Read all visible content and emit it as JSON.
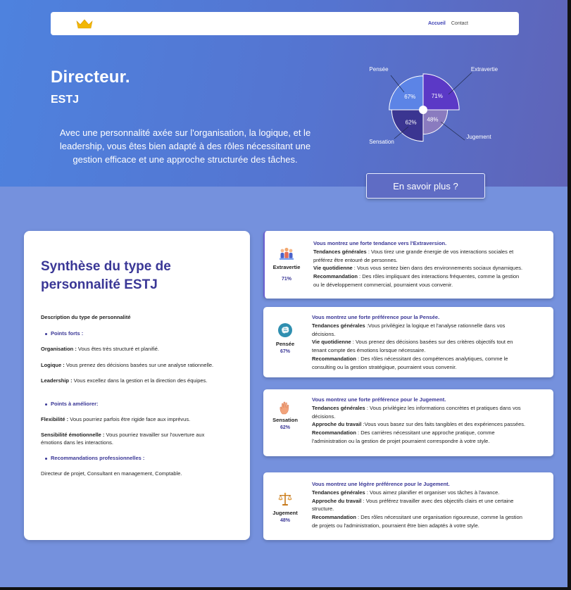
{
  "nav": {
    "logo": "crown-icon",
    "links": [
      "Accueil",
      "Contact"
    ],
    "active_link": "Accueil"
  },
  "hero": {
    "title": "Directeur.",
    "subtitle": "ESTJ",
    "description": " Avec une personnalité axée sur l'organisation, la logique, et le leadership, vous êtes bien adapté à des rôles nécessitant une gestion efficace et une approche structurée des tâches.",
    "cta_label": "En savoir plus ?"
  },
  "chart_data": {
    "type": "pie",
    "categories": [
      "Extravertie",
      "Jugement",
      "Sensation",
      "Pensée"
    ],
    "values": [
      71,
      48,
      62,
      67
    ],
    "value_labels": [
      "71%",
      "48%",
      "62%",
      "67%"
    ],
    "colors": [
      "#5b39c6",
      "#8a7bbf",
      "#3b3591",
      "#5c84e6"
    ]
  },
  "summary": {
    "title": "Synthèse du type de personnalité ESTJ",
    "description_heading": "Description du type de personnalité",
    "strengths_heading": "Points forts :",
    "strengths": [
      {
        "label": "Organisation :",
        "text": " Vous êtes très structuré et planifié."
      },
      {
        "label": "Logique :",
        "text": " Vous prenez des décisions basées sur une analyse rationnelle."
      },
      {
        "label": "Leadership :",
        "text": " Vous excellez dans la gestion et la direction des équipes."
      }
    ],
    "improve_heading": "Points à améliorer:",
    "improvements": [
      {
        "label": "Flexibilité :",
        "text": " Vous pourriez parfois être rigide face aux imprévus."
      },
      {
        "label": "Sensibilité émotionnelle :",
        "text": " Vous pourriez travailler sur l'ouverture aux",
        "text2": "émotions dans les interactions."
      }
    ],
    "careers_heading": "Recommandations professionnelles :",
    "careers_text": "Directeur de projet, Consultant en management, Comptable."
  },
  "traits": [
    {
      "name": "Extravertie",
      "percent": "71%",
      "icon": "people-icon",
      "headline": "Vous montrez une forte tendance vers l'Extraversion.",
      "lines": [
        {
          "label": "Tendances générales",
          "text": " : Vous tirez une grande énergie de vos interactions sociales et"
        },
        {
          "label": "",
          "text": "préférez être entouré de personnes."
        },
        {
          "label": "Vie quotidienne",
          "text": " : Vous vous sentez bien dans des environnements sociaux dynamiques."
        },
        {
          "label": "Recommandation",
          "text": " : Des rôles impliquant des interactions fréquentes, comme la gestion"
        },
        {
          "label": "",
          "text": "ou le développement commercial, pourraient vous convenir."
        }
      ]
    },
    {
      "name": "Pensée",
      "percent": "67%",
      "icon": "brain-icon",
      "headline": "Vous montrez une forte préférence pour la Pensée.",
      "lines": [
        {
          "label": "Tendances générales",
          "text": " :Vous privilégiez la logique et l'analyse rationnelle dans vos"
        },
        {
          "label": "",
          "text": "décisions."
        },
        {
          "label": "Vie quotidienne",
          "text": " :  Vous prenez des décisions basées sur des critères objectifs tout en"
        },
        {
          "label": "",
          "text": "tenant compte des émotions lorsque nécessaire."
        },
        {
          "label": "Recommandation",
          "text": " : Des rôles nécessitant des compétences analytiques, comme le"
        },
        {
          "label": "",
          "text": "consulting ou la gestion stratégique, pourraient vous convenir."
        }
      ]
    },
    {
      "name": "Sensation",
      "percent": "62%",
      "icon": "hand-icon",
      "headline": "Vous montrez une forte préférence pour le Jugement.",
      "lines": [
        {
          "label": "Tendances générales",
          "text": " : Vous privilégiez les informations concrètes et pratiques dans vos"
        },
        {
          "label": "",
          "text": "décisions."
        },
        {
          "label": "Approche du travail",
          "text": " :Vous vous basez sur des faits tangibles et des expériences passées."
        },
        {
          "label": "Recommandation",
          "text": " : Des carrières nécessitant une approche pratique, comme"
        },
        {
          "label": "",
          "text": "l'administration ou la gestion de projet pourraient correspondre à votre style."
        }
      ]
    },
    {
      "name": "Jugement",
      "percent": "48%",
      "icon": "scales-icon",
      "headline": "Vous montrez une légère  préférence pour le Jugement.",
      "lines": [
        {
          "label": "Tendances générales",
          "text": " : Vous aimez planifier et organiser vos tâches à l'avance."
        },
        {
          "label": "Approche du travail",
          "text": " : Vous préférez travailler avec des objectifs clairs et une certaine"
        },
        {
          "label": "",
          "text": "structure."
        },
        {
          "label": "Recommandation",
          "text": " :  Des rôles nécessitant une organisation rigoureuse, comme la gestion"
        },
        {
          "label": "",
          "text": "de projets ou l'administration, pourraient être bien adaptés à votre style."
        }
      ]
    }
  ]
}
